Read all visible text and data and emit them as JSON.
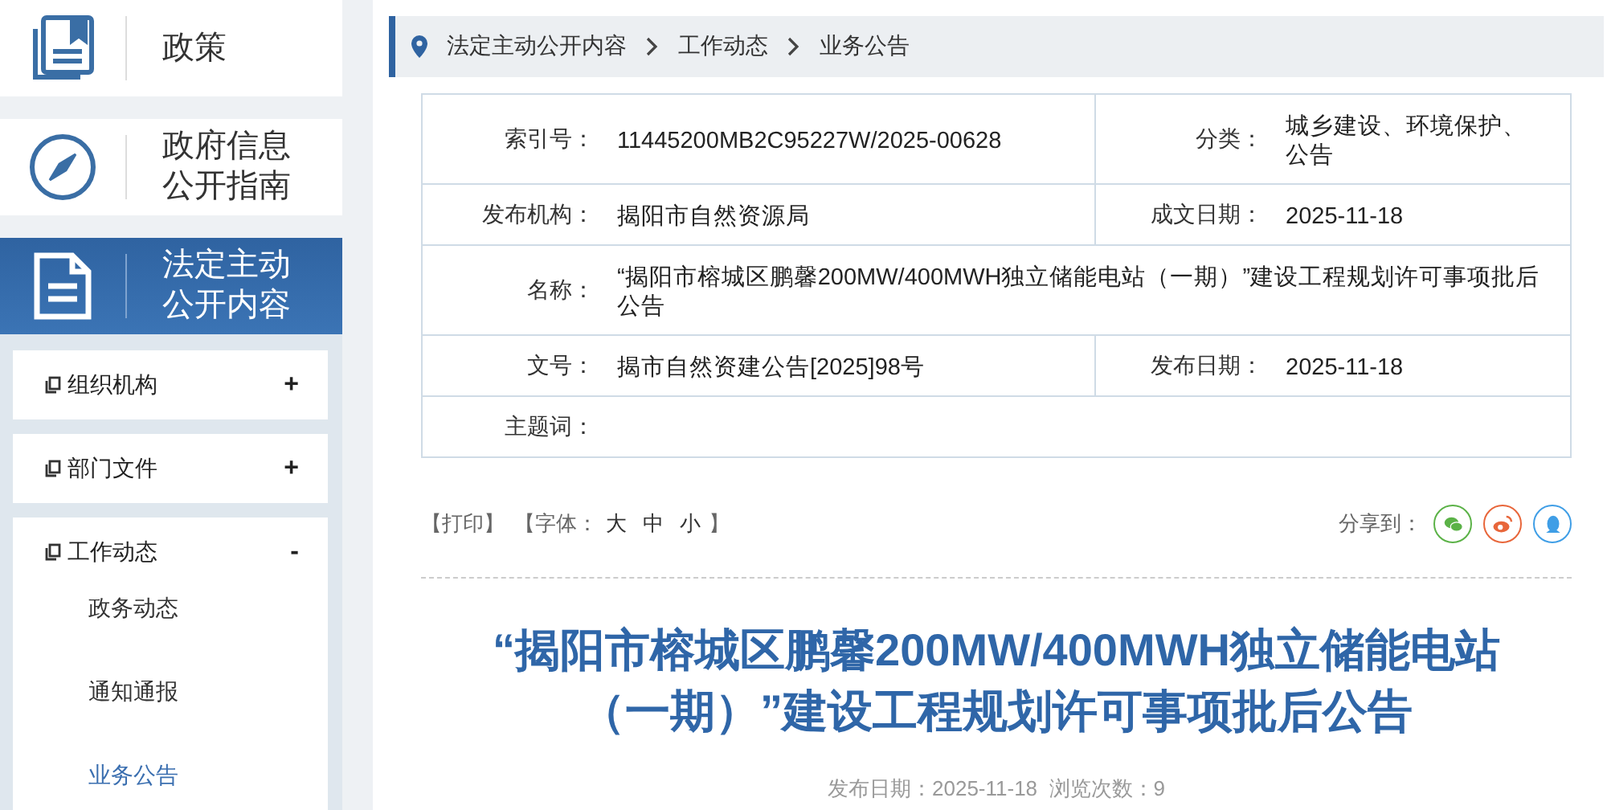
{
  "sidebar": {
    "nav_cards": [
      {
        "kind": "book",
        "lines": [
          "政策"
        ],
        "selected": false
      },
      {
        "kind": "compass",
        "lines": [
          "政府信息",
          "公开指南"
        ],
        "selected": false
      },
      {
        "kind": "document",
        "lines": [
          "法定主动",
          "公开内容"
        ],
        "selected": true
      }
    ],
    "menu": [
      {
        "label": "组织机构",
        "toggle": "+"
      },
      {
        "label": "部门文件",
        "toggle": "+"
      },
      {
        "label": "工作动态",
        "toggle": "-",
        "children": [
          {
            "label": "政务动态",
            "selected": false
          },
          {
            "label": "通知通报",
            "selected": false
          },
          {
            "label": "业务公告",
            "selected": true
          }
        ]
      }
    ]
  },
  "breadcrumb": [
    "法定主动公开内容",
    "工作动态",
    "业务公告"
  ],
  "info_table": [
    [
      {
        "label": "索引号：",
        "value": "11445200MB2C95227W/2025-00628"
      },
      {
        "label": "分类：",
        "value": "城乡建设、环境保护、公告"
      }
    ],
    [
      {
        "label": "发布机构：",
        "value": "揭阳市自然资源局"
      },
      {
        "label": "成文日期：",
        "value": "2025-11-18"
      }
    ],
    [
      {
        "label": "名称：",
        "value": "“揭阳市榕城区鹏馨200MW/400MWH独立储能电站（一期）”建设工程规划许可事项批后公告"
      }
    ],
    [
      {
        "label": "文号：",
        "value": "揭市自然资建公告[2025]98号"
      },
      {
        "label": "发布日期：",
        "value": "2025-11-18"
      }
    ],
    [
      {
        "label": "主题词："
      }
    ]
  ],
  "tools": {
    "print": "【打印】",
    "font_label": "【字体：",
    "font_sizes": [
      "大",
      "中",
      "小"
    ],
    "font_end": "】",
    "share_label": "分享到：",
    "share": [
      {
        "kind": "wechat",
        "color": "#5bb247"
      },
      {
        "kind": "weibo",
        "color": "#e8663a"
      },
      {
        "kind": "qq",
        "color": "#3f9ee6"
      }
    ]
  },
  "title": "“揭阳市榕城区鹏馨200MW/400MWH独立储能电站（一期）”建设工程规划许可事项批后公告",
  "meta": "发布日期：2025-11-18  浏览次数：9"
}
